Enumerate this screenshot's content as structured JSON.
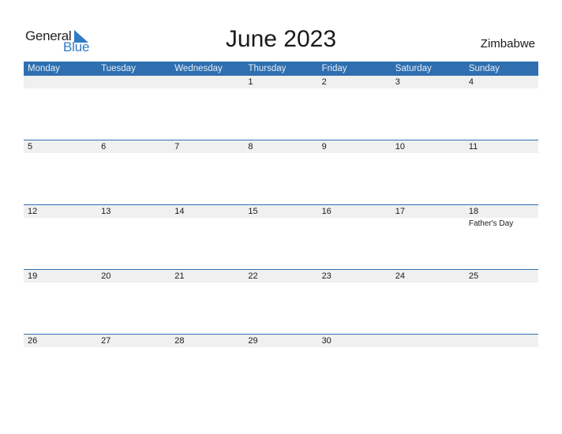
{
  "logo": {
    "line1": "General",
    "line2": "Blue"
  },
  "title": "June 2023",
  "country": "Zimbabwe",
  "colors": {
    "header_bg": "#2f6fb0",
    "brand_blue": "#2f7bc4",
    "day_row_bg": "#f0f0f0"
  },
  "weekdays": [
    "Monday",
    "Tuesday",
    "Wednesday",
    "Thursday",
    "Friday",
    "Saturday",
    "Sunday"
  ],
  "weeks": [
    {
      "days": [
        "",
        "",
        "",
        "1",
        "2",
        "3",
        "4"
      ],
      "events": [
        "",
        "",
        "",
        "",
        "",
        "",
        ""
      ]
    },
    {
      "days": [
        "5",
        "6",
        "7",
        "8",
        "9",
        "10",
        "11"
      ],
      "events": [
        "",
        "",
        "",
        "",
        "",
        "",
        ""
      ]
    },
    {
      "days": [
        "12",
        "13",
        "14",
        "15",
        "16",
        "17",
        "18"
      ],
      "events": [
        "",
        "",
        "",
        "",
        "",
        "",
        "Father's Day"
      ]
    },
    {
      "days": [
        "19",
        "20",
        "21",
        "22",
        "23",
        "24",
        "25"
      ],
      "events": [
        "",
        "",
        "",
        "",
        "",
        "",
        ""
      ]
    },
    {
      "days": [
        "26",
        "27",
        "28",
        "29",
        "30",
        "",
        ""
      ],
      "events": [
        "",
        "",
        "",
        "",
        "",
        "",
        ""
      ]
    }
  ]
}
